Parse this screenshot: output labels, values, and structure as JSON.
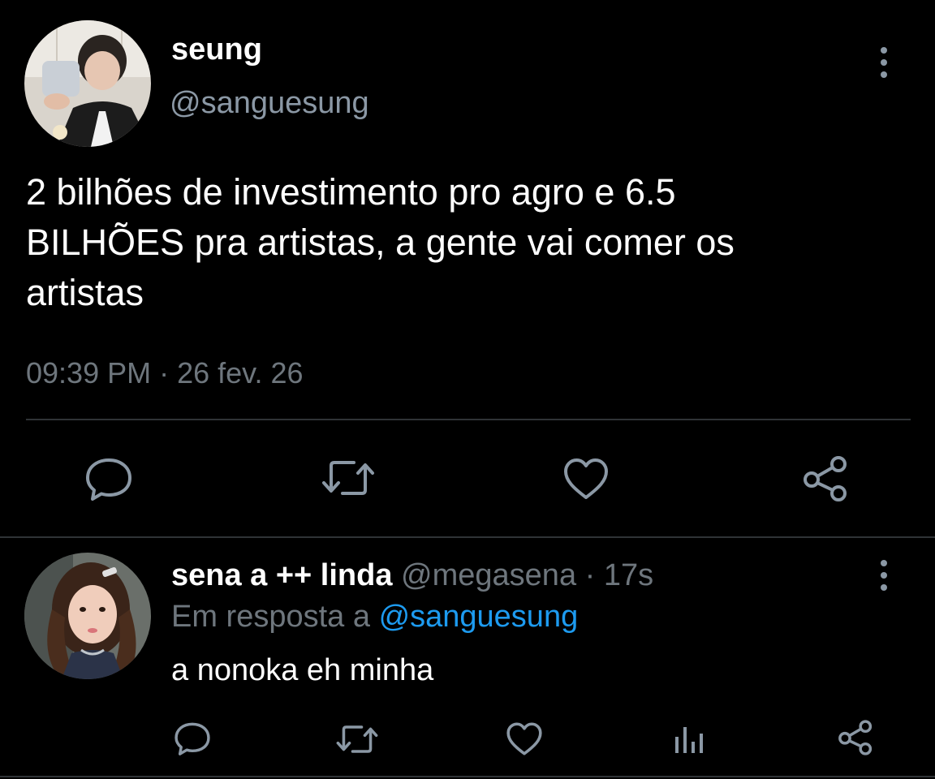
{
  "tweet": {
    "author_name": "seung",
    "author_handle": "@sanguesung",
    "text": "2 bilhões de investimento pro agro e 6.5\nBILHÕES pra artistas, a gente vai comer os\nartistas",
    "time": "09:39 PM",
    "separator": "·",
    "date": "26 fev. 26",
    "icons": {
      "menu": "more-vertical-icon",
      "reply": "comment-icon",
      "retweet": "retweet-icon",
      "like": "heart-icon",
      "share": "share-icon"
    }
  },
  "reply": {
    "author_name": "sena a ++ linda",
    "author_handle": "@megasena",
    "separator": "·",
    "time": "17s",
    "in_reply_prefix": "Em resposta a",
    "in_reply_mention": "@sanguesung",
    "text": "a nonoka eh minha",
    "icons": {
      "menu": "more-vertical-icon",
      "reply": "comment-icon",
      "retweet": "retweet-icon",
      "like": "heart-icon",
      "analytics": "analytics-icon",
      "share": "share-icon"
    }
  },
  "colors": {
    "background": "#000000",
    "primary_text": "#ffffff",
    "secondary_text": "#6e767d",
    "accent_link": "#1d9bf0",
    "icon": "#8b98a5",
    "divider": "#2f3336"
  }
}
